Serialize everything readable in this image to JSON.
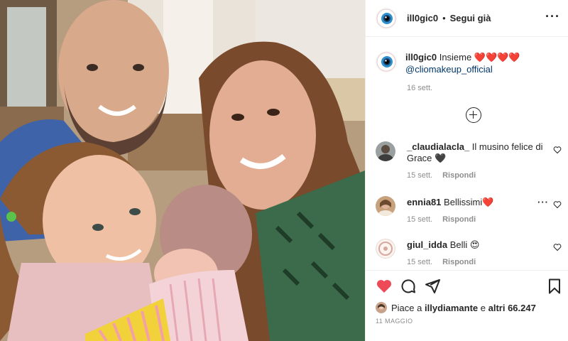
{
  "post": {
    "author": "ill0gic0",
    "separator": "•",
    "follow_status": "Segui già",
    "more_icon": "more-horizontal-icon",
    "caption": {
      "username": "ill0gic0",
      "text": "Insieme",
      "emoji": "❤️❤️❤️❤️",
      "mention": "@cliomakeup_official",
      "time": "16 sett."
    },
    "load_more_icon": "plus-circle-icon"
  },
  "comments": [
    {
      "username": "_claudialacla_",
      "text": "Il musino felice di Grace 🖤",
      "time": "15 sett.",
      "reply": "Rispondi"
    },
    {
      "username": "ennia81",
      "text": "Bellissimi❤️",
      "time": "15 sett.",
      "reply": "Rispondi"
    },
    {
      "username": "giul_idda",
      "text": "Belli 😍",
      "time": "15 sett.",
      "reply": "Rispondi"
    }
  ],
  "actions": {
    "like_icon": "heart-filled-icon",
    "comment_icon": "comment-icon",
    "share_icon": "share-icon",
    "save_icon": "bookmark-icon",
    "liked_by_prefix": "Piace a",
    "liked_by_user": "illydiamante",
    "liked_by_join": "e",
    "likes_count": "altri 66.247",
    "date": "11 MAGGIO"
  },
  "colors": {
    "like_red": "#ed4956",
    "link_blue": "#00376b",
    "muted_text": "#8e8e8e",
    "border": "#efefef"
  }
}
